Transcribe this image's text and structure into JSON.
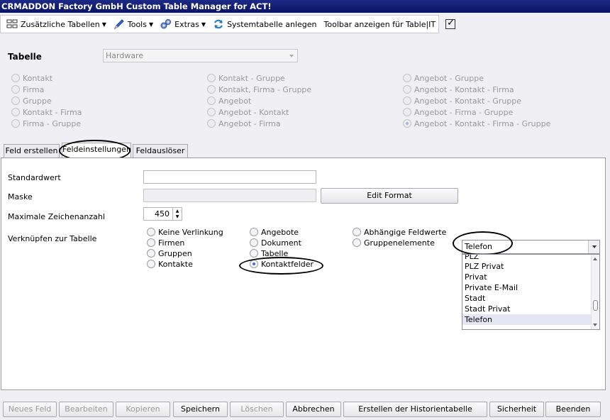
{
  "window": {
    "title": "CRMADDON Factory GmbH Custom Table Manager for ACT!"
  },
  "toolbar": {
    "items": [
      {
        "label": "Zusätzliche Tabellen",
        "icon": "tables-icon"
      },
      {
        "label": "Tools",
        "icon": "pen-icon"
      },
      {
        "label": "Extras",
        "icon": "gears-icon"
      },
      {
        "label": "Systemtabelle anlegen",
        "icon": "refresh-icon"
      },
      {
        "label": "Toolbar anzeigen für Table|IT"
      }
    ]
  },
  "table_section": {
    "label": "Tabelle",
    "combo_value": "Hardware",
    "radios": [
      [
        "Kontakt",
        "Firma",
        "Gruppe",
        "Kontakt - Firma",
        "Firma - Gruppe"
      ],
      [
        "Kontakt - Gruppe",
        "Kontakt, Firma - Gruppe",
        "Angebot",
        "Angebot - Kontakt",
        "Angebot - Firma"
      ],
      [
        "Angebot - Gruppe",
        "Angebot - Kontakt - Firma",
        "Angebot - Kontakt - Gruppe",
        "Angebot - Firma - Gruppe",
        "Angebot - Kontakt - Firma - Gruppe"
      ]
    ],
    "selected": "Angebot - Kontakt - Firma - Gruppe"
  },
  "tabs": [
    "Feld erstellen",
    "Feldeinstellungen",
    "Feldauslöser"
  ],
  "active_tab": "Feldeinstellungen",
  "form": {
    "standardwert_label": "Standardwert",
    "standardwert_value": "",
    "maske_label": "Maske",
    "edit_format_label": "Edit Format",
    "max_chars_label": "Maximale Zeichenanzahl",
    "max_chars_value": "450",
    "link_label": "Verknüpfen zur Tabelle",
    "link_options": [
      [
        "Keine Verlinkung",
        "Firmen",
        "Gruppen",
        "Kontakte"
      ],
      [
        "Angebote",
        "Dokument",
        "Tabelle",
        "Kontaktfelder"
      ],
      [
        "Abhängige Feldwerte",
        "Gruppenelemente"
      ]
    ],
    "link_selected": "Kontaktfelder"
  },
  "field_combo": {
    "value": "Telefon",
    "list": [
      "PLZ",
      "PLZ Privat",
      "Privat",
      "Private E-Mail",
      "Stadt",
      "Stadt Privat",
      "Telefon"
    ],
    "highlighted": "Telefon"
  },
  "bottom_buttons": [
    {
      "label": "Neues Feld",
      "enabled": false
    },
    {
      "label": "Bearbeiten",
      "enabled": false
    },
    {
      "label": "Kopieren",
      "enabled": false
    },
    {
      "label": "Speichern",
      "enabled": true
    },
    {
      "label": "Löschen",
      "enabled": false
    },
    {
      "label": "Abbrechen",
      "enabled": true
    },
    {
      "label": "Erstellen der Historientabelle",
      "enabled": true
    },
    {
      "label": "Sicherheit",
      "enabled": true
    },
    {
      "label": "Beenden",
      "enabled": true
    }
  ]
}
